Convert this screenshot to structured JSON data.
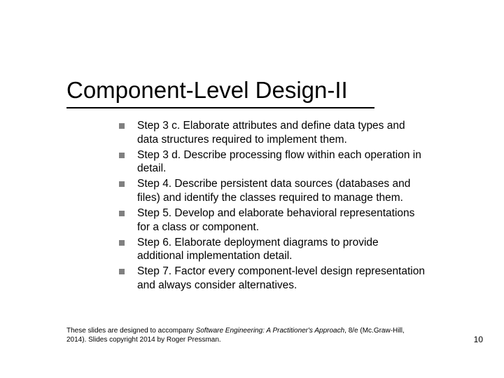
{
  "title": "Component-Level Design-II",
  "bullets": [
    "Step 3 c.  Elaborate attributes and define data types and data structures required to implement them.",
    "Step 3 d.  Describe processing flow within each operation in detail.",
    "Step 4.  Describe persistent data sources (databases and files) and identify the classes required to manage them.",
    "Step 5.  Develop and elaborate behavioral representations for a class or component.",
    "Step 6.  Elaborate deployment diagrams to provide additional implementation detail.",
    "Step 7.  Factor every component-level design representation and always consider alternatives."
  ],
  "footer": {
    "pre": "These slides are designed to accompany ",
    "book": "Software Engineering: A Practitioner's Approach",
    "post": ", 8/e (Mc.Graw-Hill, 2014). Slides copyright 2014 by Roger Pressman."
  },
  "page_number": "10"
}
